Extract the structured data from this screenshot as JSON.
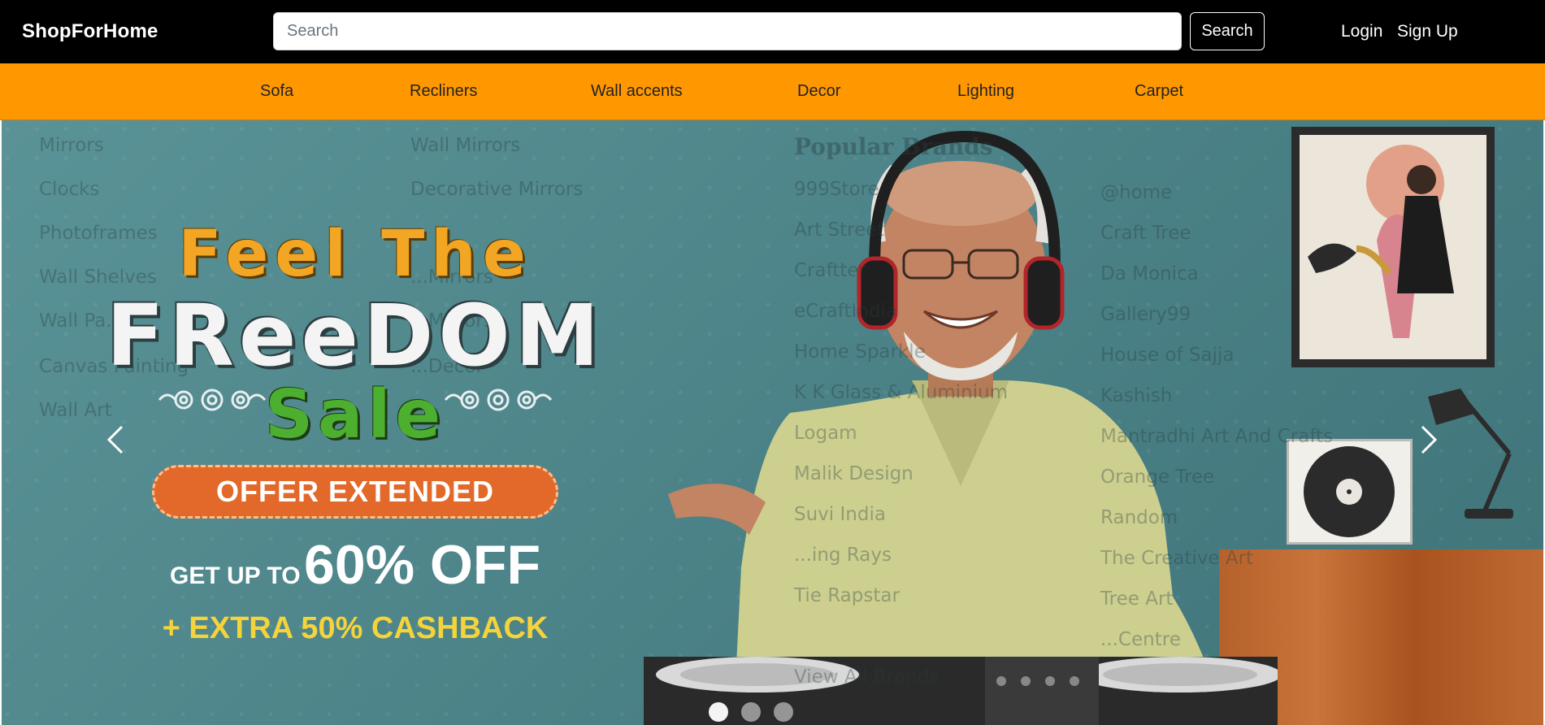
{
  "header": {
    "brand": "ShopForHome",
    "search_placeholder": "Search",
    "search_button": "Search",
    "login": "Login",
    "signup": "Sign Up"
  },
  "categories": [
    "Sofa",
    "Recliners",
    "Wall accents",
    "Decor",
    "Lighting",
    "Carpet"
  ],
  "banner": {
    "line1": "Feel The",
    "line2": "FReeDOM",
    "line3": "Sale",
    "offer": "OFFER EXTENDED",
    "get_up_to": "GET UP TO",
    "discount": "60% OFF",
    "cashback": "+ EXTRA 50% CASHBACK"
  },
  "dropdown": {
    "col1": [
      "Mirrors",
      "Clocks",
      "Photoframes",
      "Wall Shelves",
      "Wall Pa...",
      "Canvas Painting",
      "Wall Art"
    ],
    "col2": [
      "Wall Mirrors",
      "Decorative Mirrors",
      "",
      "...Mirrors",
      "...Mirrors",
      "...Decor"
    ],
    "brands_title": "Popular Brands",
    "brands_col1": [
      "999Store",
      "Art Street",
      "Craftter",
      "eCraftIndia",
      "Home Sparkle",
      "K K Glass & Aluminium",
      "Logam",
      "Malik Design",
      "Suvi India",
      "...ing Rays",
      "Tie Rapstar",
      "...",
      "View All Brands"
    ],
    "brands_col2": [
      "@home",
      "Craft Tree",
      "Da Monica",
      "Gallery99",
      "House of Sajja",
      "Kashish",
      "Mantradhi Art And Crafts",
      "Orange Tree",
      "Random",
      "The Creative Art",
      "Tree Art",
      "...Centre"
    ]
  },
  "carousel": {
    "slide_count": 3,
    "active_index": 0
  },
  "colors": {
    "topbar": "#000000",
    "category_bar": "#ff9800",
    "banner_bg": "#4f878b",
    "accent_orange": "#e2692a",
    "accent_yellow": "#f5d33a",
    "accent_green": "#4caf2f"
  }
}
